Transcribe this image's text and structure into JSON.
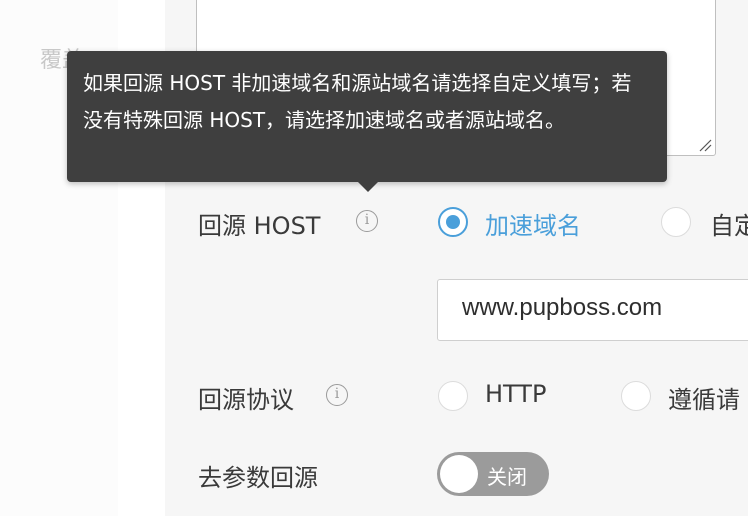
{
  "form": {
    "partial_label": "覆盖",
    "host_row": {
      "label": "回源 HOST",
      "options": [
        {
          "label": "加速域名",
          "checked": true
        },
        {
          "label": "自定",
          "checked": false
        }
      ],
      "value": "www.pupboss.com"
    },
    "protocol_row": {
      "label": "回源协议",
      "options": [
        {
          "label": "HTTP",
          "checked": false
        },
        {
          "label": "遵循请",
          "checked": false
        }
      ]
    },
    "param_row": {
      "label": "去参数回源",
      "toggle_label": "关闭",
      "toggle_on": false
    }
  },
  "tooltip": {
    "text": "如果回源 HOST 非加速域名和源站域名请选择自定义填写；若没有特殊回源 HOST，请选择加速域名或者源站域名。"
  },
  "colors": {
    "accent": "#4a9fda",
    "tooltip_bg": "#3f3f3f",
    "toggle_off": "#9b9b9b"
  },
  "icons": {
    "info": "info-icon",
    "resize": "resize-grip-icon"
  }
}
